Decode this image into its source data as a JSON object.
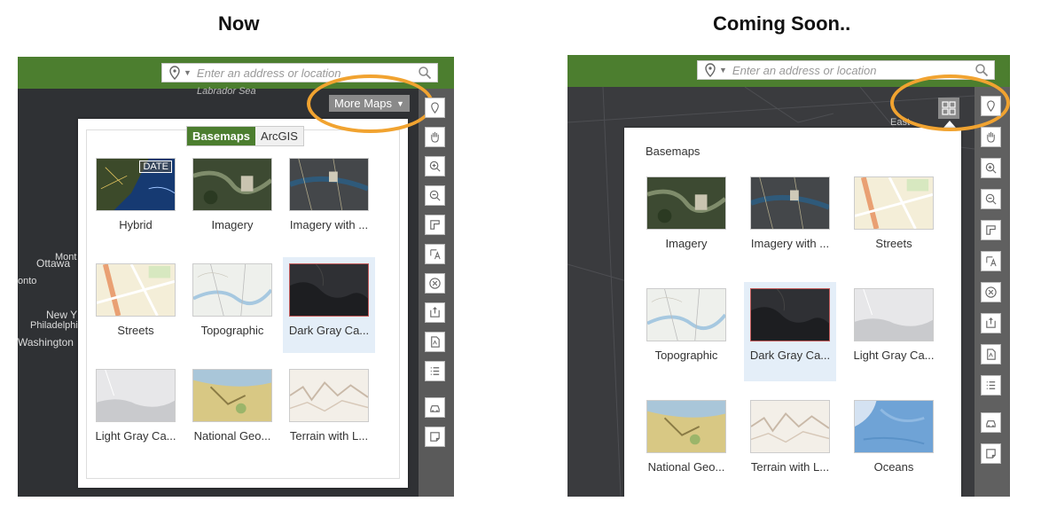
{
  "headings": {
    "left": "Now",
    "right": "Coming Soon.."
  },
  "search": {
    "placeholder": "Enter an address or location"
  },
  "now": {
    "more_maps_label": "More Maps",
    "tabs": [
      {
        "label": "Basemaps",
        "active": true
      },
      {
        "label": "ArcGIS",
        "active": false
      }
    ],
    "map_labels": [
      "Labrador Sea",
      "Ottawa",
      "Mont",
      "onto",
      "New Y",
      "Philadelphi",
      "Washington"
    ],
    "items": [
      {
        "label": "Hybrid",
        "kind": "hybrid",
        "badge": "DATE"
      },
      {
        "label": "Imagery",
        "kind": "imagery"
      },
      {
        "label": "Imagery with ...",
        "kind": "imagery2"
      },
      {
        "label": "Streets",
        "kind": "streets"
      },
      {
        "label": "Topographic",
        "kind": "topo"
      },
      {
        "label": "Dark Gray Ca...",
        "kind": "dark",
        "selected": true
      },
      {
        "label": "Light Gray Ca...",
        "kind": "light"
      },
      {
        "label": "National Geo...",
        "kind": "natgeo"
      },
      {
        "label": "Terrain with L...",
        "kind": "terrain"
      }
    ]
  },
  "soon": {
    "gallery_title": "Basemaps",
    "map_labels": [
      "East"
    ],
    "items": [
      {
        "label": "Imagery",
        "kind": "imagery"
      },
      {
        "label": "Imagery with ...",
        "kind": "imagery2"
      },
      {
        "label": "Streets",
        "kind": "streets"
      },
      {
        "label": "Topographic",
        "kind": "topo"
      },
      {
        "label": "Dark Gray Ca...",
        "kind": "dark",
        "selected": true
      },
      {
        "label": "Light Gray Ca...",
        "kind": "light"
      },
      {
        "label": "National Geo...",
        "kind": "natgeo"
      },
      {
        "label": "Terrain with L...",
        "kind": "terrain"
      },
      {
        "label": "Oceans",
        "kind": "oceans"
      }
    ]
  },
  "tools": [
    "location-icon",
    "pan-hand-icon",
    "zoom-in-icon",
    "zoom-out-icon",
    "measure-icon",
    "text-tool-icon",
    "clear-icon",
    "share-icon",
    "pdf-icon",
    "legend-list-icon",
    "directions-car-icon",
    "note-icon"
  ],
  "colors": {
    "header_green": "#4c7e2f",
    "highlight_orange": "#f1a330",
    "map_dark": "#2f3134",
    "selected_bg": "#e4eef8"
  }
}
